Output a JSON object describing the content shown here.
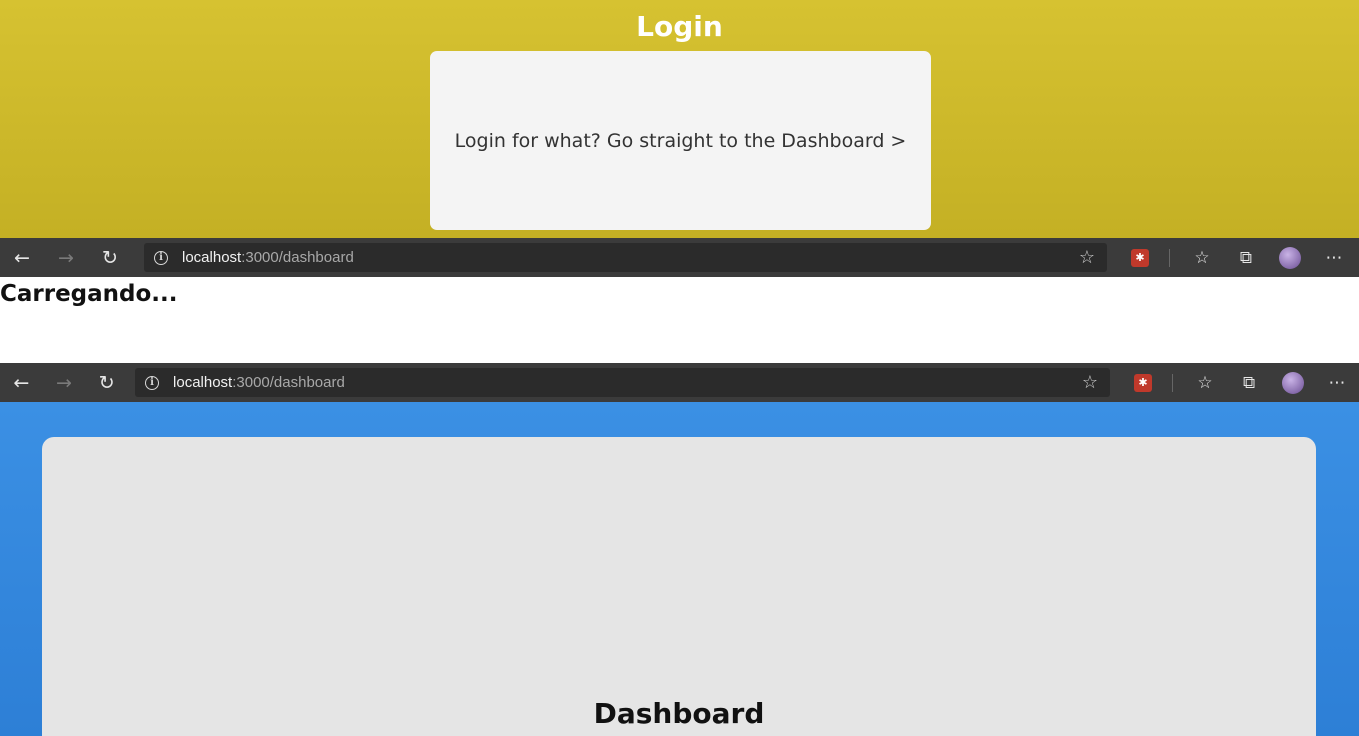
{
  "login": {
    "title": "Login",
    "link_text": "Login for what? Go straight to the Dashboard >"
  },
  "browser": {
    "url_host": "localhost",
    "url_rest": ":3000/dashboard",
    "back_icon": "arrow-left-icon",
    "forward_icon": "arrow-right-icon",
    "refresh_icon": "refresh-icon"
  },
  "loading": {
    "text": "Carregando..."
  },
  "dashboard": {
    "title": "Dashboard"
  },
  "colors": {
    "login_bg": "#d6c231",
    "dashboard_bg": "#3b90e4",
    "toolbar_bg": "#3b3b3b"
  }
}
